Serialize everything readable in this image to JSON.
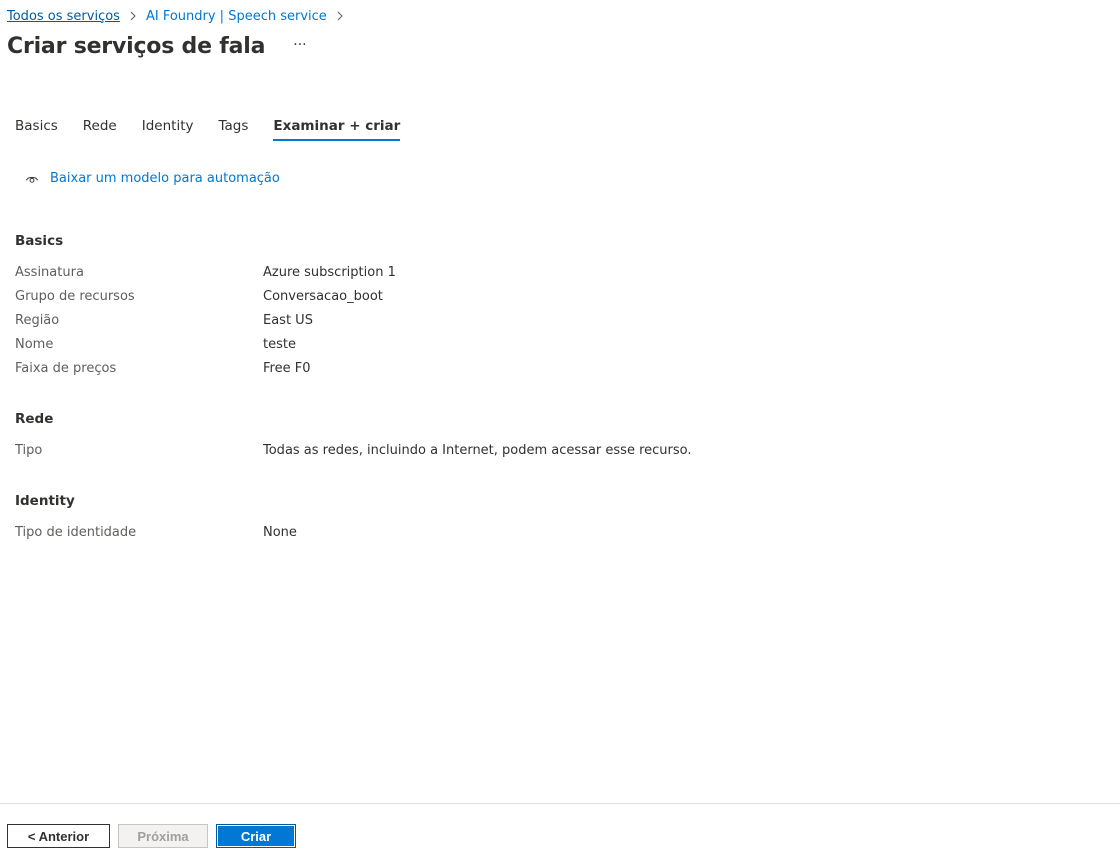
{
  "breadcrumb": {
    "items": [
      "Todos os serviços",
      "AI Foundry | Speech service"
    ]
  },
  "header": {
    "title": "Criar serviços de fala",
    "more_label": "···"
  },
  "tabs": [
    {
      "label": "Basics"
    },
    {
      "label": "Rede"
    },
    {
      "label": "Identity"
    },
    {
      "label": "Tags"
    },
    {
      "label": "Examinar + criar",
      "active": true
    }
  ],
  "template_link": {
    "label": "Baixar um modelo para automação",
    "icon": "eye-icon"
  },
  "sections": {
    "basics": {
      "title": "Basics",
      "rows": [
        {
          "label": "Assinatura",
          "value": "Azure subscription 1"
        },
        {
          "label": "Grupo de recursos",
          "value": "Conversacao_boot"
        },
        {
          "label": "Região",
          "value": "East US"
        },
        {
          "label": "Nome",
          "value": "teste"
        },
        {
          "label": "Faixa de preços",
          "value": "Free F0"
        }
      ]
    },
    "rede": {
      "title": "Rede",
      "rows": [
        {
          "label": "Tipo",
          "value": "Todas as redes, incluindo a Internet, podem acessar esse recurso."
        }
      ]
    },
    "identity": {
      "title": "Identity",
      "rows": [
        {
          "label": "Tipo de identidade",
          "value": "None"
        }
      ]
    }
  },
  "footer": {
    "prev_label": "< Anterior",
    "next_label": "Próxima",
    "create_label": "Criar"
  },
  "colors": {
    "accent": "#0078d4",
    "text": "#323130",
    "muted": "#605e5c"
  }
}
